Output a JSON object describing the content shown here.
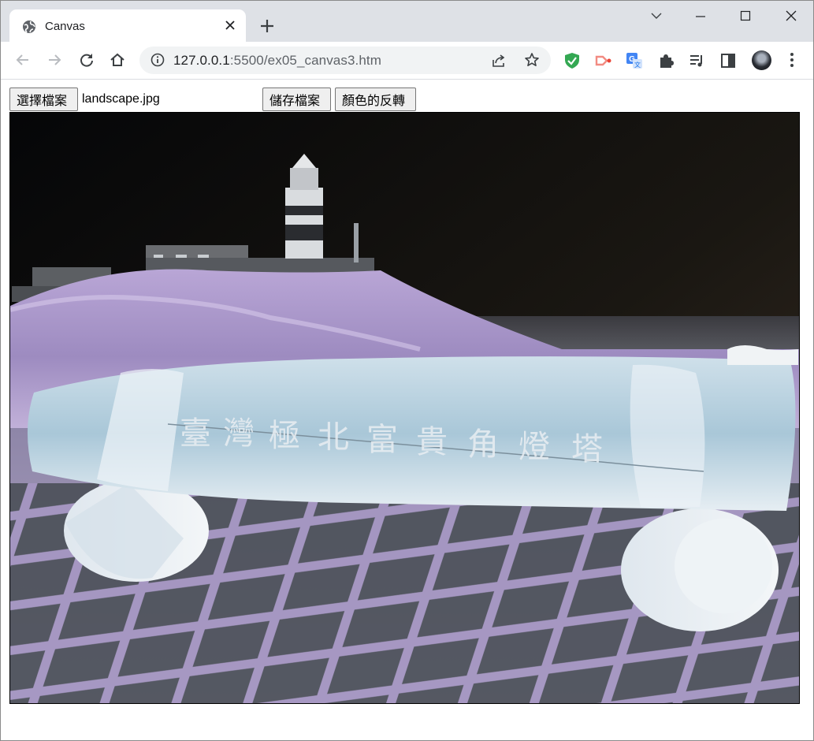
{
  "tab": {
    "title": "Canvas",
    "favicon": "globe-icon"
  },
  "window_controls": [
    "chevron-down-icon",
    "minimize-icon",
    "maximize-icon",
    "close-icon"
  ],
  "omnibox": {
    "url_host": "127.0.0.1",
    "url_path": ":5500/ex05_canvas3.htm"
  },
  "extensions": [
    "shield-check-icon",
    "cast-icon",
    "translate-icon",
    "puzzle-icon",
    "media-queue-icon",
    "side-panel-icon"
  ],
  "page": {
    "choose_file_label": "選擇檔案",
    "file_name": "landscape.jpg",
    "save_file_label": "儲存檔案",
    "invert_color_label": "顏色的反轉"
  },
  "canvas_image": {
    "description_tag": "inverted-landscape-photo",
    "stone_inscription": "臺灣極北富貴角燈塔"
  },
  "colors": {
    "tabstrip": "#dee1e6",
    "accent_shield": "#34a853"
  }
}
